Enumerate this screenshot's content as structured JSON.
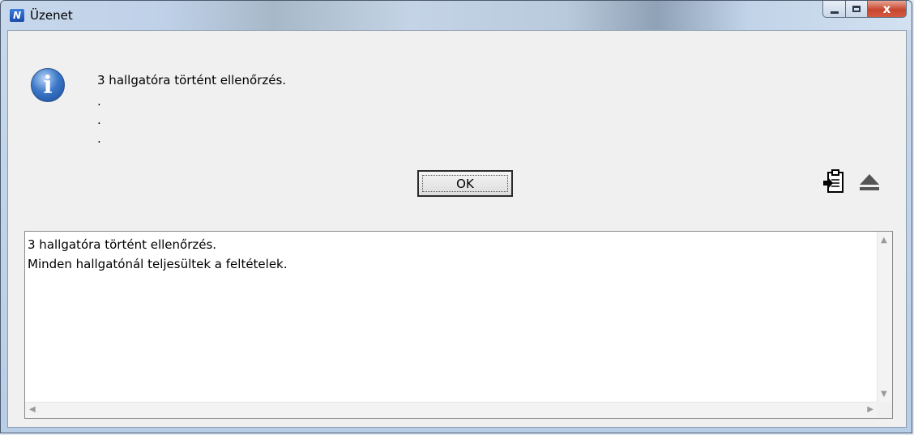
{
  "window": {
    "title": "Üzenet",
    "app_icon": "N",
    "controls": {
      "close": "x"
    }
  },
  "message": {
    "main": "3 hallgatóra történt ellenőrzés.",
    "dots": [
      ".",
      ".",
      "."
    ]
  },
  "buttons": {
    "ok_label": "OK"
  },
  "details": {
    "lines": [
      "3 hallgatóra történt ellenőrzés.",
      "Minden hallgatónál teljesültek a feltételek."
    ]
  },
  "icons": {
    "info": "info-icon",
    "copy": "clipboard-icon",
    "collapse": "eject-icon"
  },
  "colors": {
    "close_button": "#c7462f",
    "info_icon": "#3c78c8"
  }
}
